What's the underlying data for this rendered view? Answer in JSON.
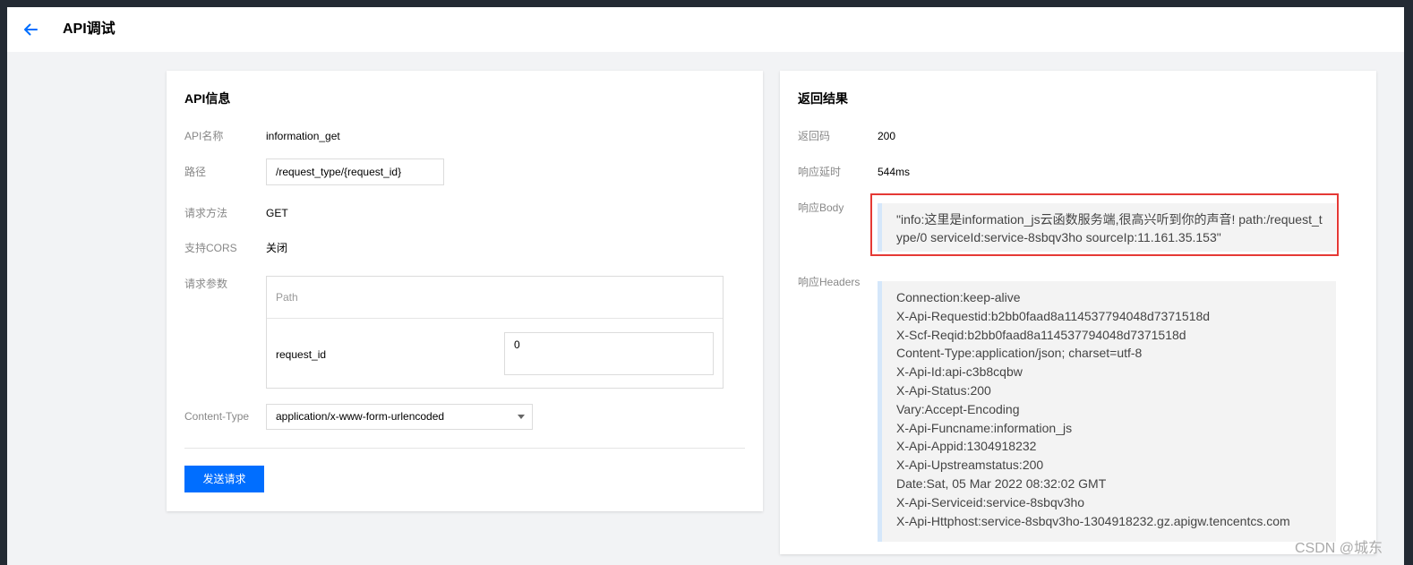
{
  "header": {
    "title": "API调试"
  },
  "api_info": {
    "title": "API信息",
    "name_label": "API名称",
    "name_value": "information_get",
    "path_label": "路径",
    "path_value": "/request_type/{request_id}",
    "method_label": "请求方法",
    "method_value": "GET",
    "cors_label": "支持CORS",
    "cors_value": "关闭",
    "params_label": "请求参数",
    "params_section": "Path",
    "param_name": "request_id",
    "param_value": "0",
    "content_type_label": "Content-Type",
    "content_type_value": "application/x-www-form-urlencoded",
    "send_label": "发送请求"
  },
  "result": {
    "title": "返回结果",
    "code_label": "返回码",
    "code_value": "200",
    "latency_label": "响应延时",
    "latency_value": "544ms",
    "body_label": "响应Body",
    "body_value": "\"info:这里是information_js云函数服务端,很高兴听到你的声音! path:/request_type/0 serviceId:service-8sbqv3ho sourceIp:11.161.35.153\"",
    "headers_label": "响应Headers",
    "headers": [
      "Connection:keep-alive",
      "X-Api-Requestid:b2bb0faad8a114537794048d7371518d",
      "X-Scf-Reqid:b2bb0faad8a114537794048d7371518d",
      "Content-Type:application/json; charset=utf-8",
      "X-Api-Id:api-c3b8cqbw",
      "X-Api-Status:200",
      "Vary:Accept-Encoding",
      "X-Api-Funcname:information_js",
      "X-Api-Appid:1304918232",
      "X-Api-Upstreamstatus:200",
      "Date:Sat, 05 Mar 2022 08:32:02 GMT",
      "X-Api-Serviceid:service-8sbqv3ho",
      "X-Api-Httphost:service-8sbqv3ho-1304918232.gz.apigw.tencentcs.com"
    ]
  },
  "watermark": "CSDN @城东",
  "colors": {
    "accent": "#006eff",
    "highlight": "#e53935",
    "topbar_frame": "#232a33"
  },
  "icons": {
    "back": "arrow-left-icon",
    "dropdown": "caret-down-icon"
  }
}
